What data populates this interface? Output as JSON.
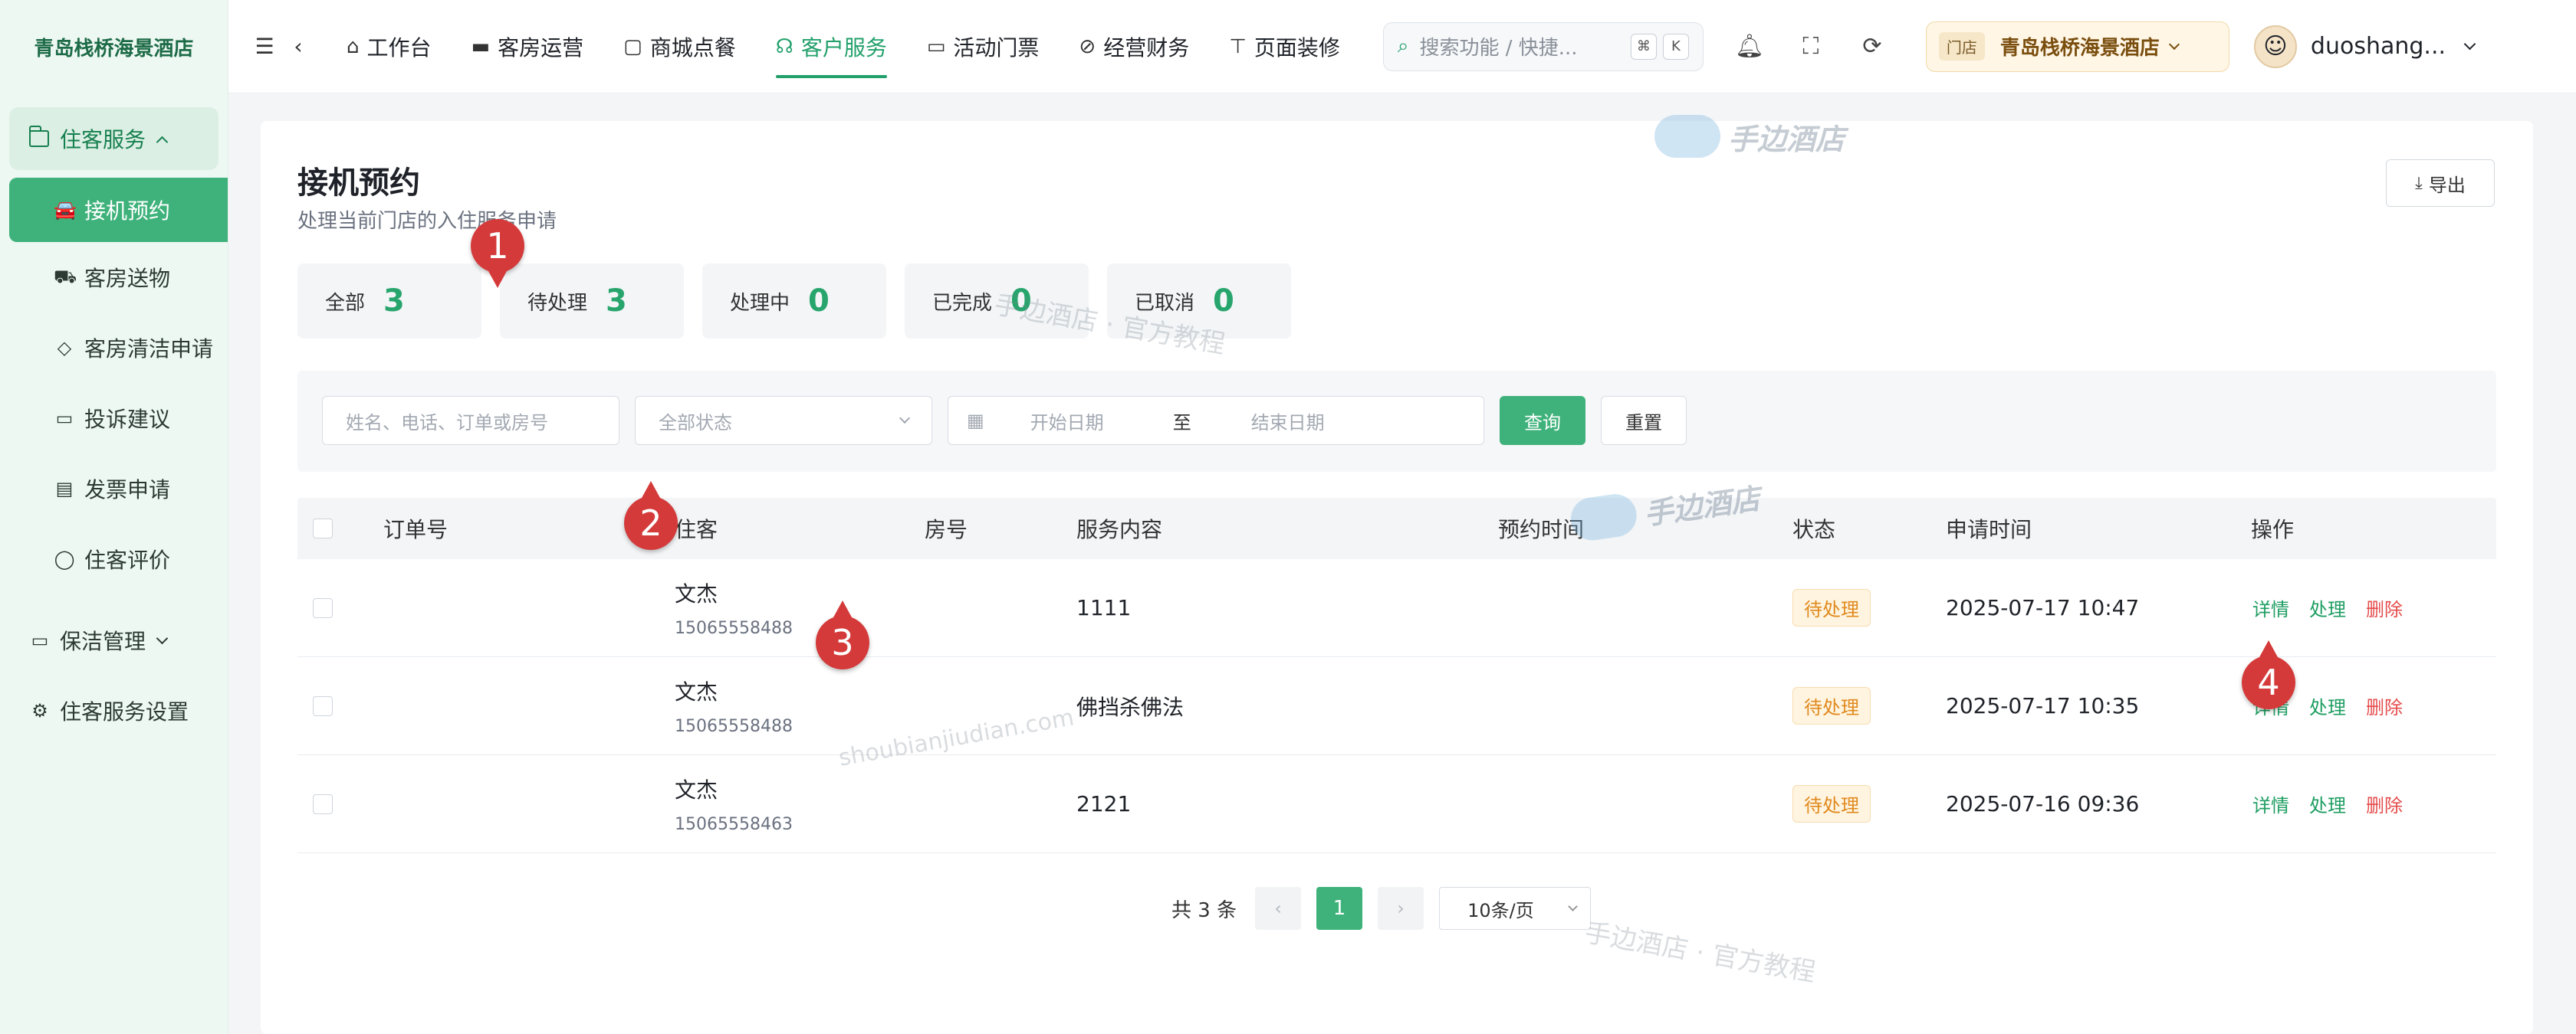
{
  "sidebar": {
    "brand": "青岛栈桥海景酒店",
    "group_main": "住客服务",
    "items": [
      {
        "label": "接机预约",
        "icon": "car-icon"
      },
      {
        "label": "客房送物",
        "icon": "truck-icon"
      },
      {
        "label": "客房清洁申请",
        "icon": "broom-icon"
      },
      {
        "label": "投诉建议",
        "icon": "comment-icon"
      },
      {
        "label": "发票申请",
        "icon": "invoice-icon"
      },
      {
        "label": "住客评价",
        "icon": "chat-icon"
      }
    ],
    "group_cleaning": "保洁管理",
    "settings": "住客服务设置"
  },
  "topbar": {
    "menu": [
      {
        "label": "工作台",
        "icon": "home-icon"
      },
      {
        "label": "客房运营",
        "icon": "bed-icon"
      },
      {
        "label": "商城点餐",
        "icon": "bag-icon"
      },
      {
        "label": "客户服务",
        "icon": "headset-icon"
      },
      {
        "label": "活动门票",
        "icon": "ticket-icon"
      },
      {
        "label": "经营财务",
        "icon": "finance-icon"
      },
      {
        "label": "页面装修",
        "icon": "brush-icon"
      }
    ],
    "search_placeholder": "搜索功能 / 快捷...",
    "kbd": [
      "⌘",
      "K"
    ],
    "store_tag": "门店",
    "store_name": "青岛栈桥海景酒店",
    "username": "duoshang..."
  },
  "page": {
    "title": "接机预约",
    "subtitle": "处理当前门店的入住服务申请",
    "export_label": "导出"
  },
  "stats": [
    {
      "label": "全部",
      "value": "3"
    },
    {
      "label": "待处理",
      "value": "3"
    },
    {
      "label": "处理中",
      "value": "0"
    },
    {
      "label": "已完成",
      "value": "0"
    },
    {
      "label": "已取消",
      "value": "0"
    }
  ],
  "filters": {
    "keyword_placeholder": "姓名、电话、订单或房号",
    "status_placeholder": "全部状态",
    "start_date": "开始日期",
    "to": "至",
    "end_date": "结束日期",
    "query_label": "查询",
    "reset_label": "重置"
  },
  "table": {
    "headers": [
      "订单号",
      "住客",
      "房号",
      "服务内容",
      "预约时间",
      "状态",
      "申请时间",
      "操作"
    ],
    "rows": [
      {
        "order": "",
        "guest_name": "文杰",
        "guest_phone": "15065558488",
        "room": "",
        "service": "1111",
        "appointment": "",
        "status": "待处理",
        "applied": "2025-07-17 10:47"
      },
      {
        "order": "",
        "guest_name": "文杰",
        "guest_phone": "15065558488",
        "room": "",
        "service": "佛挡杀佛法",
        "appointment": "",
        "status": "待处理",
        "applied": "2025-07-17 10:35"
      },
      {
        "order": "",
        "guest_name": "文杰",
        "guest_phone": "15065558463",
        "room": "",
        "service": "2121",
        "appointment": "",
        "status": "待处理",
        "applied": "2025-07-16 09:36"
      }
    ],
    "actions": {
      "detail": "详情",
      "handle": "处理",
      "delete": "删除"
    }
  },
  "pagination": {
    "total": "共 3 条",
    "current": "1",
    "page_size": "10条/页"
  },
  "watermarks": {
    "logo_text": "手边酒店",
    "tutorial": "手边酒店 · 官方教程",
    "domain": "shoubianjiudian.com"
  },
  "markers": [
    "1",
    "2",
    "3",
    "4"
  ],
  "colors": {
    "accent": "#3fb27b",
    "pending": "#e08a1e",
    "danger": "#e54c4c"
  }
}
